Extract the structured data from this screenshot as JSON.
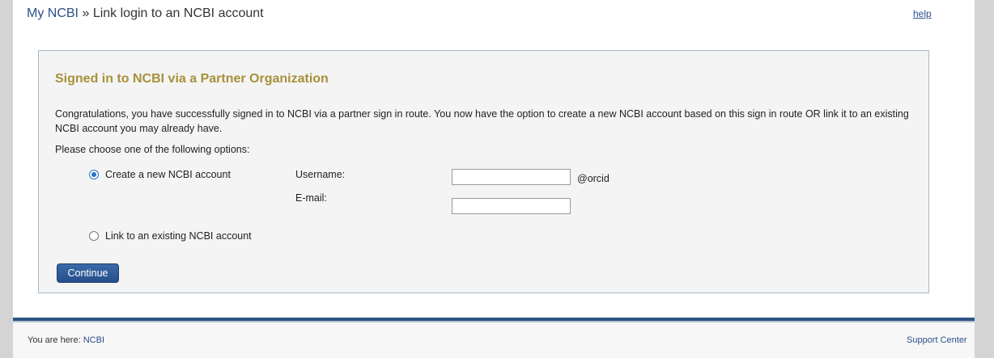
{
  "breadcrumb": {
    "root_link": "My NCBI",
    "separator": "»",
    "current": "Link login to an NCBI account"
  },
  "header": {
    "help_link": "help"
  },
  "panel": {
    "title": "Signed in to NCBI via a Partner Organization",
    "intro": "Congratulations, you have successfully signed in to NCBI via a partner sign in route. You now have the option to create a new NCBI account based on this sign in route OR link it to an existing NCBI account you may already have.",
    "choose_label": "Please choose one of the following options:",
    "option_create": {
      "label": "Create a new NCBI account",
      "selected": true
    },
    "option_link": {
      "label": "Link to an existing NCBI account",
      "selected": false
    },
    "username": {
      "label": "Username:",
      "value": "",
      "suffix": "@orcid"
    },
    "email": {
      "label": "E-mail:",
      "value": ""
    },
    "continue_button": "Continue"
  },
  "footer": {
    "you_are_here": "You are here:",
    "you_are_here_link": "NCBI",
    "support_link": "Support Center"
  },
  "colors": {
    "title": "#a8903a",
    "link": "#2c4f8a",
    "button": "#2c5a96",
    "footer_bar": "#2c5384"
  }
}
